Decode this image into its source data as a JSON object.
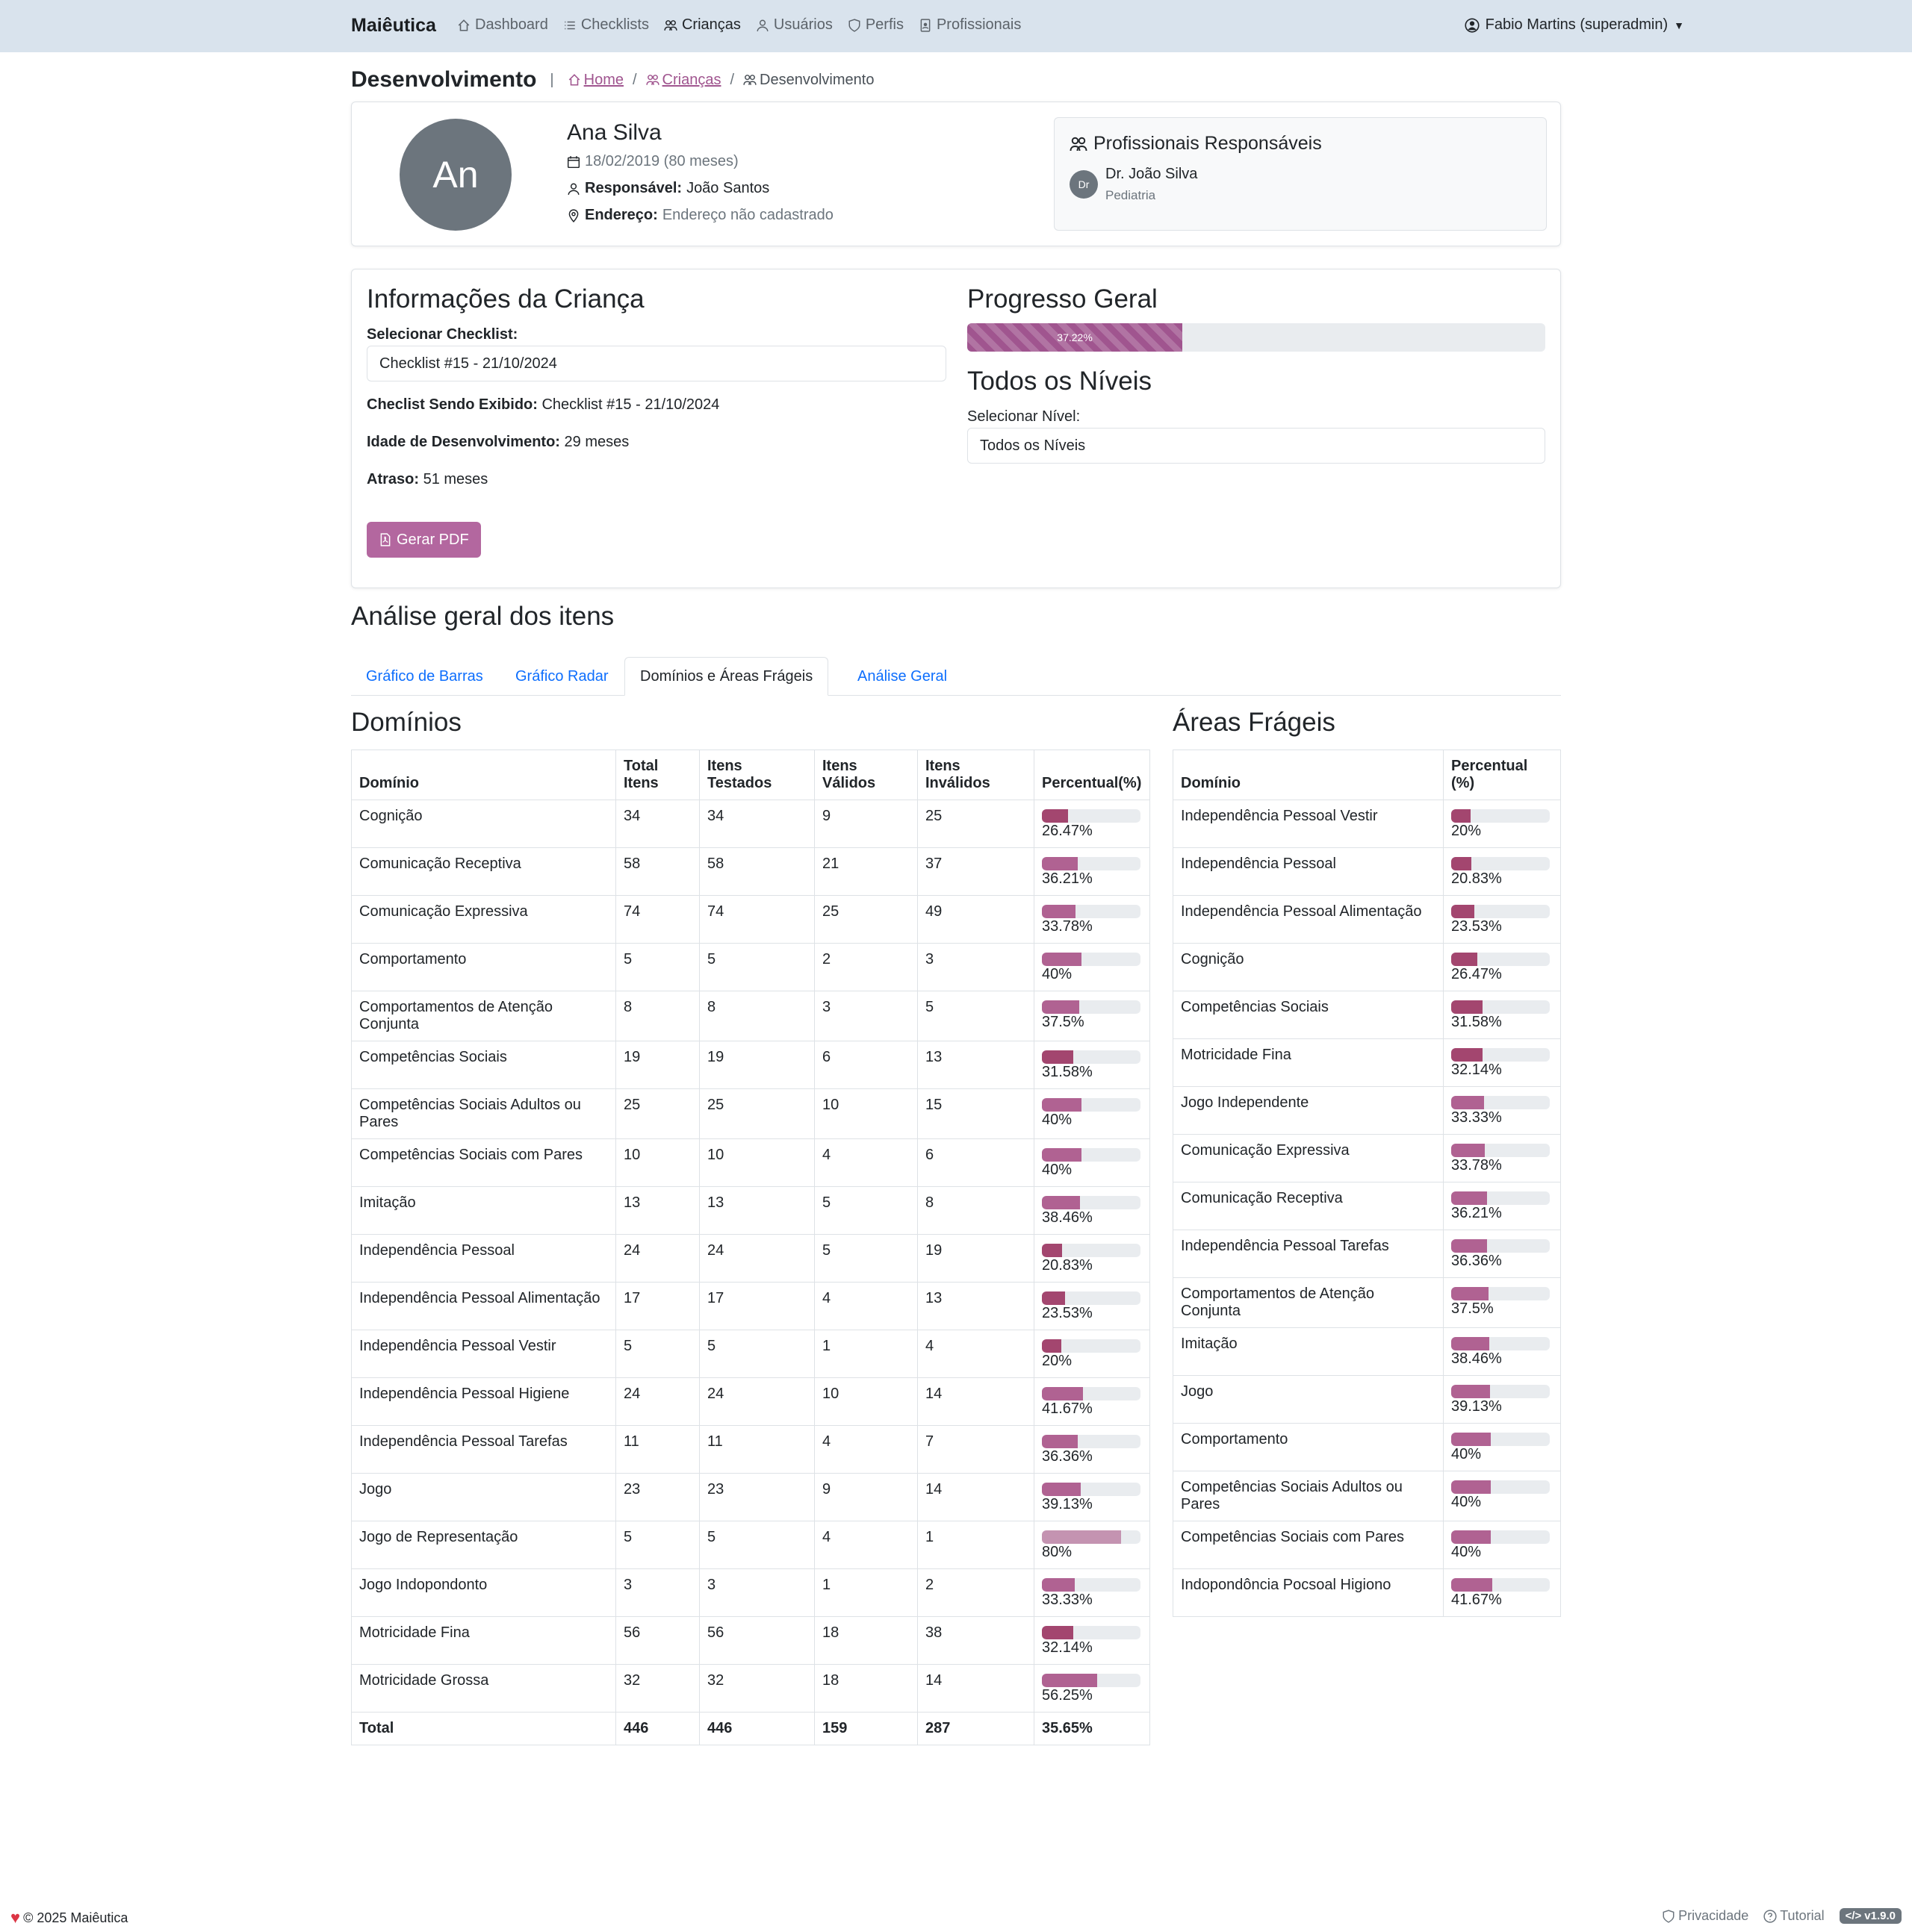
{
  "nav": {
    "brand": "Maiêutica",
    "links": [
      "Dashboard",
      "Checklists",
      "Crianças",
      "Usuários",
      "Perfis",
      "Profissionais"
    ],
    "user": "Fabio Martins (superadmin)"
  },
  "header": {
    "title": "Desenvolvimento",
    "breadcrumb": [
      "Home",
      "Crianças",
      "Desenvolvimento"
    ]
  },
  "child": {
    "initials": "An",
    "name": "Ana Silva",
    "birth": "18/02/2019 (80 meses)",
    "responsible_label": "Responsável:",
    "responsible": "João Santos",
    "address_label": "Endereço:",
    "address": "Endereço não cadastrado"
  },
  "professionals": {
    "title": "Profissionais Responsáveis",
    "items": [
      {
        "initials": "Dr",
        "name": "Dr. João Silva",
        "specialty": "Pediatria"
      }
    ]
  },
  "info": {
    "title": "Informações da Criança",
    "select_label": "Selecionar Checklist:",
    "select_value": "Checklist #15 - 21/10/2024",
    "showing_label": "Checlist Sendo Exibido:",
    "showing_value": "Checklist #15 - 21/10/2024",
    "dev_age_label": "Idade de Desenvolvimento:",
    "dev_age_value": "29 meses",
    "delay_label": "Atraso:",
    "delay_value": "51 meses",
    "pdf_button": "Gerar PDF"
  },
  "progress": {
    "title": "Progresso Geral",
    "value": 37.22,
    "text": "37.22%",
    "levels_title": "Todos os Níveis",
    "level_label": "Selecionar Nível:",
    "level_value": "Todos os Níveis"
  },
  "analysis": {
    "title": "Análise geral dos itens",
    "tabs": [
      "Gráfico de Barras",
      "Gráfico Radar",
      "Domínios e Áreas Frágeis",
      "Análise Geral"
    ],
    "active_tab": 2
  },
  "domains": {
    "title": "Domínios",
    "headers": [
      "Domínio",
      "Total Itens",
      "Itens Testados",
      "Itens Válidos",
      "Itens Inválidos",
      "Percentual(%)"
    ],
    "rows": [
      {
        "name": "Cognição",
        "total": "34",
        "tested": "34",
        "valid": "9",
        "invalid": "25",
        "pct": 26.47,
        "pct_text": "26.47%"
      },
      {
        "name": "Comunicação Receptiva",
        "total": "58",
        "tested": "58",
        "valid": "21",
        "invalid": "37",
        "pct": 36.21,
        "pct_text": "36.21%"
      },
      {
        "name": "Comunicação Expressiva",
        "total": "74",
        "tested": "74",
        "valid": "25",
        "invalid": "49",
        "pct": 33.78,
        "pct_text": "33.78%"
      },
      {
        "name": "Comportamento",
        "total": "5",
        "tested": "5",
        "valid": "2",
        "invalid": "3",
        "pct": 40,
        "pct_text": "40%"
      },
      {
        "name": "Comportamentos de Atenção Conjunta",
        "total": "8",
        "tested": "8",
        "valid": "3",
        "invalid": "5",
        "pct": 37.5,
        "pct_text": "37.5%"
      },
      {
        "name": "Competências Sociais",
        "total": "19",
        "tested": "19",
        "valid": "6",
        "invalid": "13",
        "pct": 31.58,
        "pct_text": "31.58%"
      },
      {
        "name": "Competências Sociais Adultos ou Pares",
        "total": "25",
        "tested": "25",
        "valid": "10",
        "invalid": "15",
        "pct": 40,
        "pct_text": "40%"
      },
      {
        "name": "Competências Sociais com Pares",
        "total": "10",
        "tested": "10",
        "valid": "4",
        "invalid": "6",
        "pct": 40,
        "pct_text": "40%"
      },
      {
        "name": "Imitação",
        "total": "13",
        "tested": "13",
        "valid": "5",
        "invalid": "8",
        "pct": 38.46,
        "pct_text": "38.46%"
      },
      {
        "name": "Independência Pessoal",
        "total": "24",
        "tested": "24",
        "valid": "5",
        "invalid": "19",
        "pct": 20.83,
        "pct_text": "20.83%"
      },
      {
        "name": "Independência Pessoal Alimentação",
        "total": "17",
        "tested": "17",
        "valid": "4",
        "invalid": "13",
        "pct": 23.53,
        "pct_text": "23.53%"
      },
      {
        "name": "Independência Pessoal Vestir",
        "total": "5",
        "tested": "5",
        "valid": "1",
        "invalid": "4",
        "pct": 20,
        "pct_text": "20%"
      },
      {
        "name": "Independência Pessoal Higiene",
        "total": "24",
        "tested": "24",
        "valid": "10",
        "invalid": "14",
        "pct": 41.67,
        "pct_text": "41.67%"
      },
      {
        "name": "Independência Pessoal Tarefas",
        "total": "11",
        "tested": "11",
        "valid": "4",
        "invalid": "7",
        "pct": 36.36,
        "pct_text": "36.36%"
      },
      {
        "name": "Jogo",
        "total": "23",
        "tested": "23",
        "valid": "9",
        "invalid": "14",
        "pct": 39.13,
        "pct_text": "39.13%"
      },
      {
        "name": "Jogo de Representação",
        "total": "5",
        "tested": "5",
        "valid": "4",
        "invalid": "1",
        "pct": 80,
        "pct_text": "80%"
      },
      {
        "name": "Jogo Indopondonto",
        "total": "3",
        "tested": "3",
        "valid": "1",
        "invalid": "2",
        "pct": 33.33,
        "pct_text": "33.33%"
      },
      {
        "name": "Motricidade Fina",
        "total": "56",
        "tested": "56",
        "valid": "18",
        "invalid": "38",
        "pct": 32.14,
        "pct_text": "32.14%"
      },
      {
        "name": "Motricidade Grossa",
        "total": "32",
        "tested": "32",
        "valid": "18",
        "invalid": "14",
        "pct": 56.25,
        "pct_text": "56.25%"
      }
    ],
    "totals": {
      "name": "Total",
      "total": "446",
      "tested": "446",
      "valid": "159",
      "invalid": "287",
      "pct_text": "35.65%"
    }
  },
  "fragile": {
    "title": "Áreas Frágeis",
    "headers": [
      "Domínio",
      "Percentual (%)"
    ],
    "rows": [
      {
        "name": "Independência Pessoal Vestir",
        "pct": 20,
        "pct_text": "20%"
      },
      {
        "name": "Independência Pessoal",
        "pct": 20.83,
        "pct_text": "20.83%"
      },
      {
        "name": "Independência Pessoal Alimentação",
        "pct": 23.53,
        "pct_text": "23.53%"
      },
      {
        "name": "Cognição",
        "pct": 26.47,
        "pct_text": "26.47%"
      },
      {
        "name": "Competências Sociais",
        "pct": 31.58,
        "pct_text": "31.58%"
      },
      {
        "name": "Motricidade Fina",
        "pct": 32.14,
        "pct_text": "32.14%"
      },
      {
        "name": "Jogo Independente",
        "pct": 33.33,
        "pct_text": "33.33%"
      },
      {
        "name": "Comunicação Expressiva",
        "pct": 33.78,
        "pct_text": "33.78%"
      },
      {
        "name": "Comunicação Receptiva",
        "pct": 36.21,
        "pct_text": "36.21%"
      },
      {
        "name": "Independência Pessoal Tarefas",
        "pct": 36.36,
        "pct_text": "36.36%"
      },
      {
        "name": "Comportamentos de Atenção Conjunta",
        "pct": 37.5,
        "pct_text": "37.5%"
      },
      {
        "name": "Imitação",
        "pct": 38.46,
        "pct_text": "38.46%"
      },
      {
        "name": "Jogo",
        "pct": 39.13,
        "pct_text": "39.13%"
      },
      {
        "name": "Comportamento",
        "pct": 40,
        "pct_text": "40%"
      },
      {
        "name": "Competências Sociais Adultos ou Pares",
        "pct": 40,
        "pct_text": "40%"
      },
      {
        "name": "Competências Sociais com Pares",
        "pct": 40,
        "pct_text": "40%"
      },
      {
        "name": "Indopondôncia Pocsoal Higiono",
        "pct": 41.67,
        "pct_text": "41.67%"
      }
    ]
  },
  "footer": {
    "copyright": "© 2025 Maiêutica",
    "privacy": "Privacidade",
    "tutorial": "Tutorial",
    "version": "v1.9.0"
  },
  "colors": {
    "accent": "#a0558f",
    "bar_low": "#a3466f",
    "bar_mid": "#b06292",
    "bar_high": "#c493b1",
    "navbar": "#d9e3ed"
  }
}
